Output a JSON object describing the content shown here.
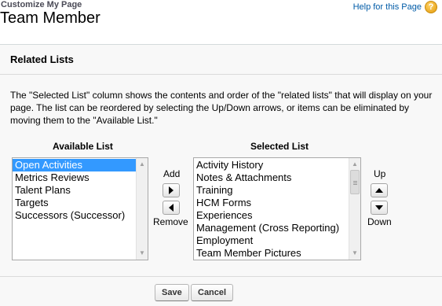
{
  "page": {
    "subtitle": "Customize My Page",
    "title": "Team Member",
    "help_link": "Help for this Page",
    "help_icon": "?"
  },
  "section": {
    "title": "Related Lists",
    "description": "The \"Selected List\" column shows the contents and order of the \"related lists\" that will display on your page. The list can be reordered by selecting the Up/Down arrows, or items can be eliminated by moving them to the \"Available List.\""
  },
  "available": {
    "label": "Available List",
    "items": [
      "Open Activities",
      "Metrics Reviews",
      "Talent Plans",
      "Targets",
      "Successors (Successor)"
    ],
    "selected_index": 0
  },
  "selected": {
    "label": "Selected List",
    "items": [
      "Activity History",
      "Notes & Attachments",
      "Training",
      "HCM Forms",
      "Experiences",
      "Management (Cross Reporting)",
      "Employment",
      "Team Member Pictures"
    ]
  },
  "controls": {
    "add_label": "Add",
    "remove_label": "Remove",
    "up_label": "Up",
    "down_label": "Down"
  },
  "buttons": {
    "save": "Save",
    "cancel": "Cancel"
  },
  "colors": {
    "link": "#015ba7",
    "selection": "#3399ff",
    "help_icon": "#e39a08"
  }
}
